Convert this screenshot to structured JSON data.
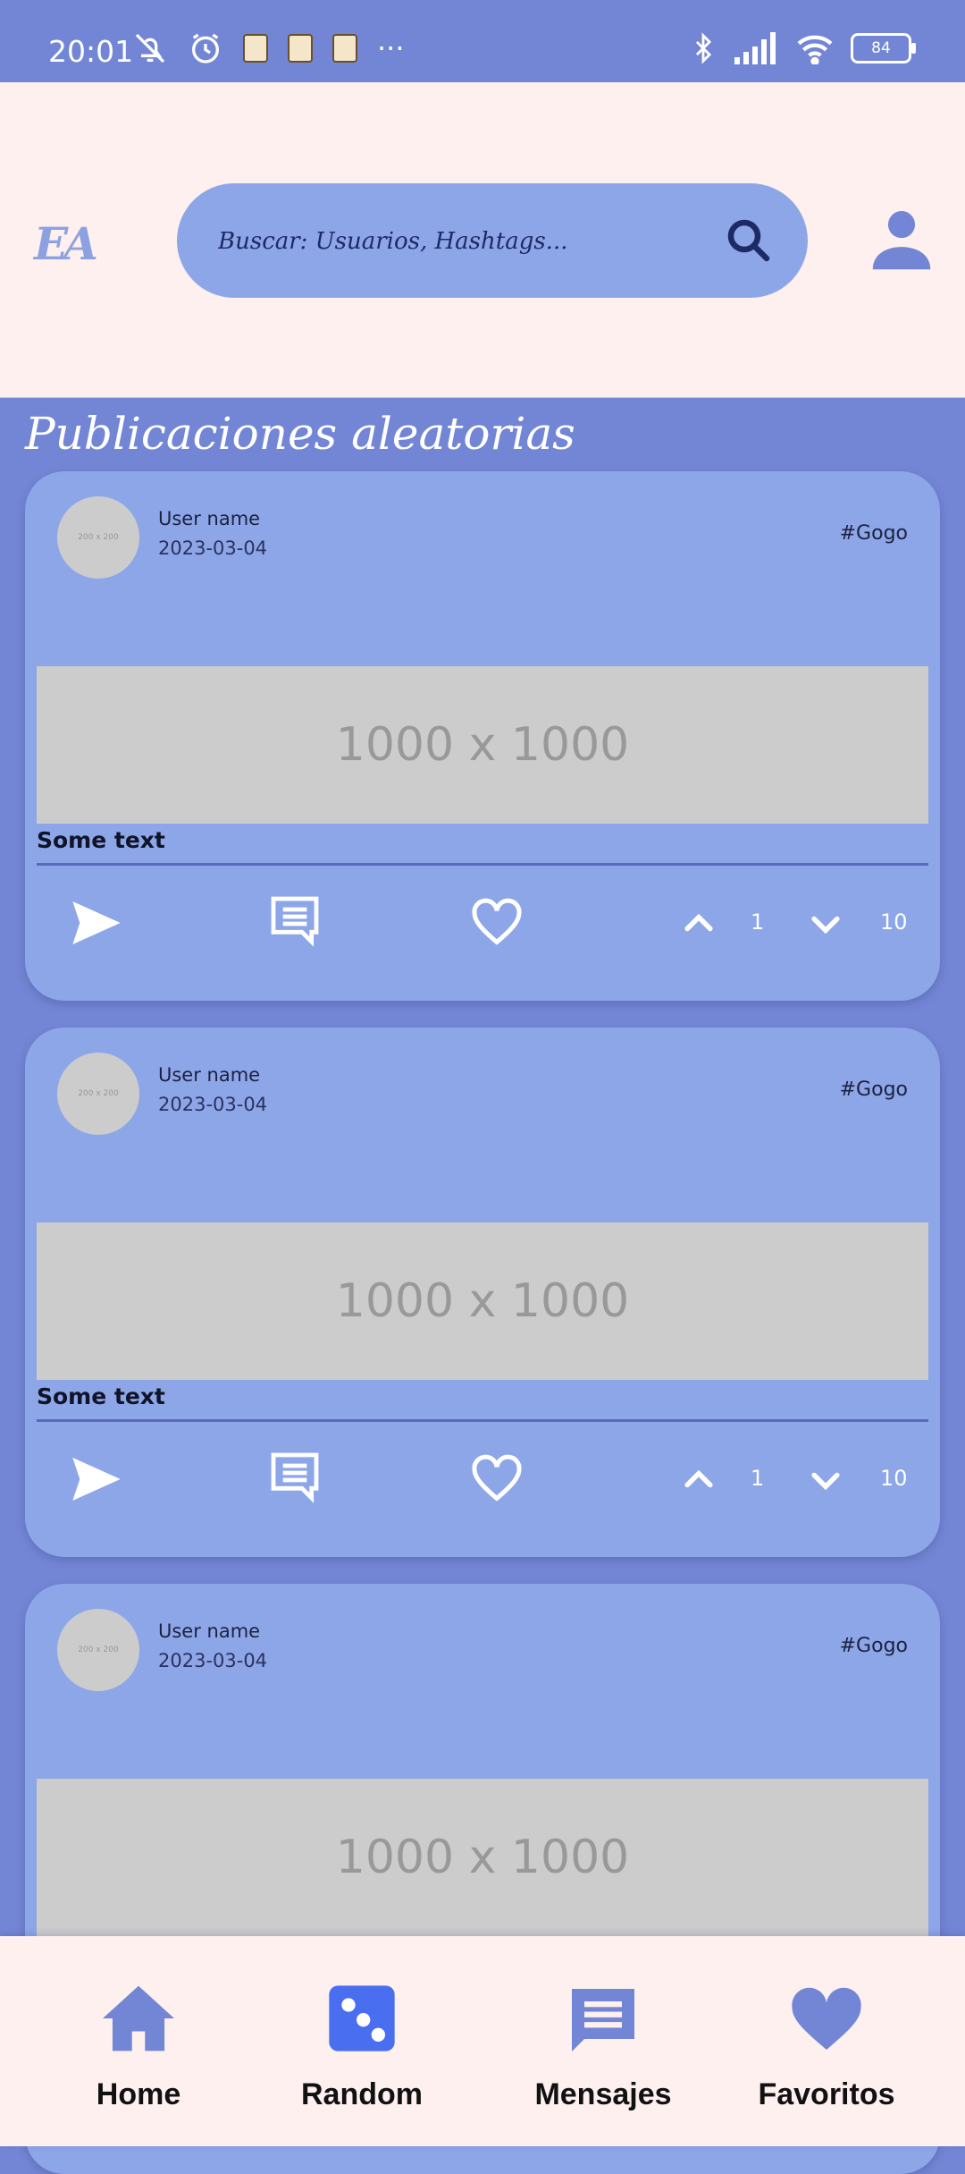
{
  "status": {
    "time": "20:01",
    "more": "···",
    "battery": "84"
  },
  "header": {
    "logo": "EA",
    "search_placeholder": "Buscar: Usuarios, Hashtags...",
    "icons": {
      "search": "search-icon",
      "account": "account-icon"
    }
  },
  "feed": {
    "title": "Publicaciones aleatorias",
    "posts": [
      {
        "avatar": "200 x 200",
        "user": "User name",
        "date": "2023-03-04",
        "hashtag": "#Gogo",
        "image": "1000 x 1000",
        "text": "Some text",
        "votes": "1",
        "views": "10"
      },
      {
        "avatar": "200 x 200",
        "user": "User name",
        "date": "2023-03-04",
        "hashtag": "#Gogo",
        "image": "1000 x 1000",
        "text": "Some text",
        "votes": "1",
        "views": "10"
      },
      {
        "avatar": "200 x 200",
        "user": "User name",
        "date": "2023-03-04",
        "hashtag": "#Gogo",
        "image": "1000 x 1000"
      }
    ]
  },
  "nav": {
    "home": "Home",
    "random": "Random",
    "messages": "Mensajes",
    "favorites": "Favoritos"
  },
  "colors": {
    "accent": "#7386d5",
    "card": "#8da6e8",
    "surface": "#fdf0ef",
    "dice": "#4a6ef0"
  }
}
